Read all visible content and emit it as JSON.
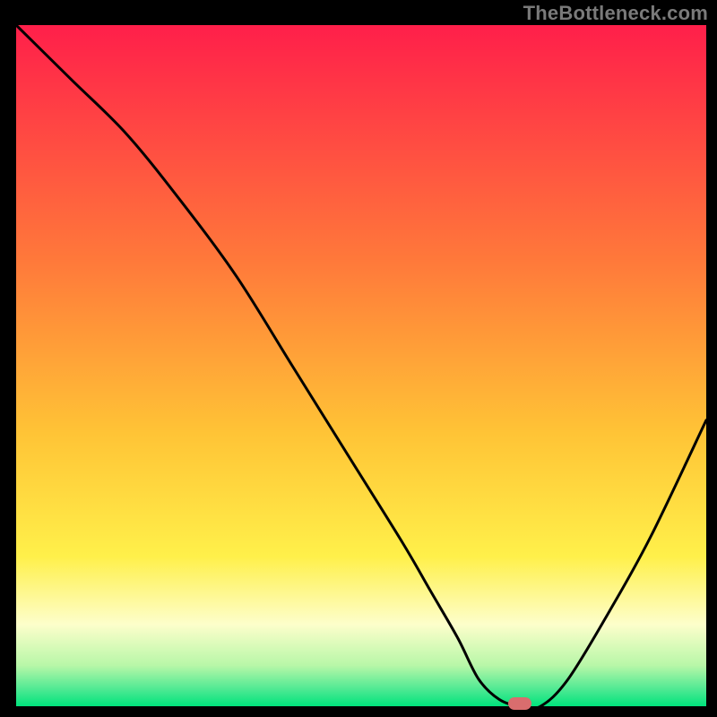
{
  "watermark": "TheBottleneck.com",
  "chart_data": {
    "type": "line",
    "title": "",
    "xlabel": "",
    "ylabel": "",
    "xlim": [
      0,
      100
    ],
    "ylim": [
      0,
      100
    ],
    "grid": false,
    "legend": false,
    "gradient_stops": [
      {
        "offset": 0.0,
        "color": "#ff1f4a"
      },
      {
        "offset": 0.35,
        "color": "#ff7a3a"
      },
      {
        "offset": 0.6,
        "color": "#ffc436"
      },
      {
        "offset": 0.78,
        "color": "#fff04a"
      },
      {
        "offset": 0.88,
        "color": "#fdfecb"
      },
      {
        "offset": 0.94,
        "color": "#b8f7a8"
      },
      {
        "offset": 0.975,
        "color": "#4fe993"
      },
      {
        "offset": 1.0,
        "color": "#00e37c"
      }
    ],
    "series": [
      {
        "name": "bottleneck-curve",
        "stroke": "#000000",
        "x": [
          0,
          8,
          16,
          24,
          32,
          40,
          48,
          56,
          60,
          64,
          67,
          70,
          73,
          76,
          80,
          86,
          92,
          100
        ],
        "y": [
          100,
          92,
          84,
          74,
          63,
          50,
          37,
          24,
          17,
          10,
          4,
          1,
          0,
          0,
          4,
          14,
          25,
          42
        ]
      }
    ],
    "marker": {
      "x": 73,
      "y": 0,
      "color": "#d96d6e",
      "shape": "pill"
    }
  }
}
